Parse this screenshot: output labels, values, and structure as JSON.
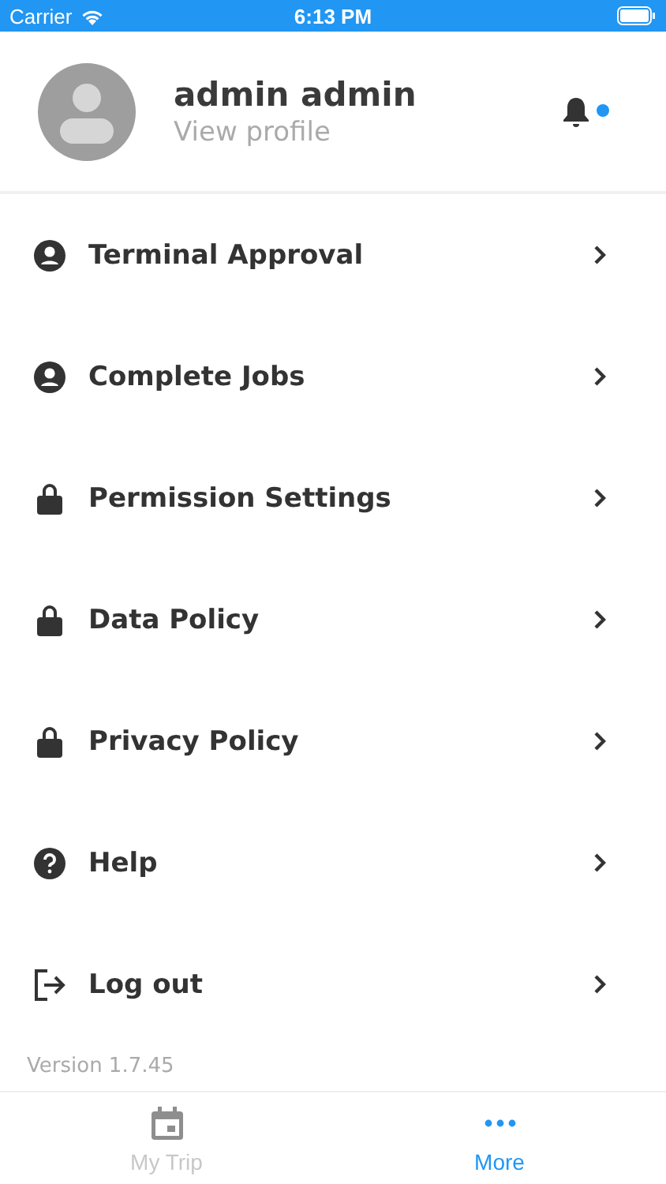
{
  "status_bar": {
    "carrier": "Carrier",
    "time": "6:13 PM"
  },
  "profile": {
    "name": "admin admin",
    "link": "View profile",
    "unread": true
  },
  "menu": [
    {
      "label": "Terminal Approval",
      "kind": "account"
    },
    {
      "label": "Complete Jobs",
      "kind": "account"
    },
    {
      "label": "Permission Settings",
      "kind": "locked"
    },
    {
      "label": "Data Policy",
      "kind": "locked"
    },
    {
      "label": "Privacy Policy",
      "kind": "locked"
    },
    {
      "label": "Help",
      "kind": "help"
    },
    {
      "label": "Log out",
      "kind": "logout"
    }
  ],
  "version": "Version 1.7.45",
  "tabs": [
    {
      "label": "My Trip",
      "kind": "calendar",
      "selected": false
    },
    {
      "label": "More",
      "kind": "more",
      "selected": true
    }
  ]
}
